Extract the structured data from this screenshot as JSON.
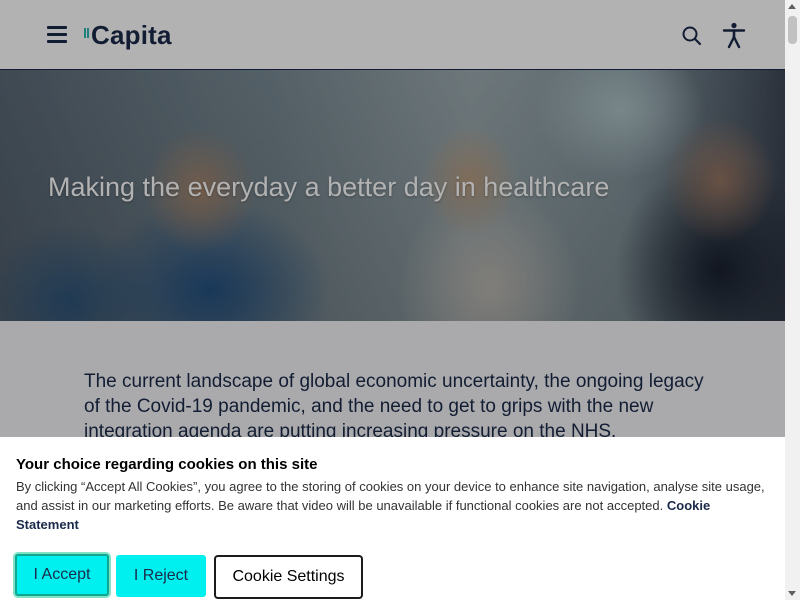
{
  "header": {
    "logo_text": "Capita",
    "brand_accent": "#2fb8b0",
    "brand_dark": "#1b2a4a",
    "icons": [
      "menu-icon",
      "search-icon",
      "accessibility-icon"
    ]
  },
  "hero": {
    "title": "Making the everyday a better day in healthcare"
  },
  "intro": {
    "text": "The current landscape of global economic uncertainty, the ongoing legacy of the Covid-19 pandemic, and the need to get to grips with the new integration agenda are putting increasing pressure on the NHS."
  },
  "cookie_banner": {
    "title": "Your choice regarding cookies on this site",
    "body": "By clicking “Accept All Cookies”, you agree to the storing of cookies on your device to enhance site navigation, analyse site usage, and assist in our marketing efforts. Be aware that video will be unavailable if functional cookies are not accepted.",
    "link_label": "Cookie Statement",
    "accept_label": "I Accept",
    "reject_label": "I Reject",
    "settings_label": "Cookie Settings",
    "button_color": "#00f0f0"
  }
}
